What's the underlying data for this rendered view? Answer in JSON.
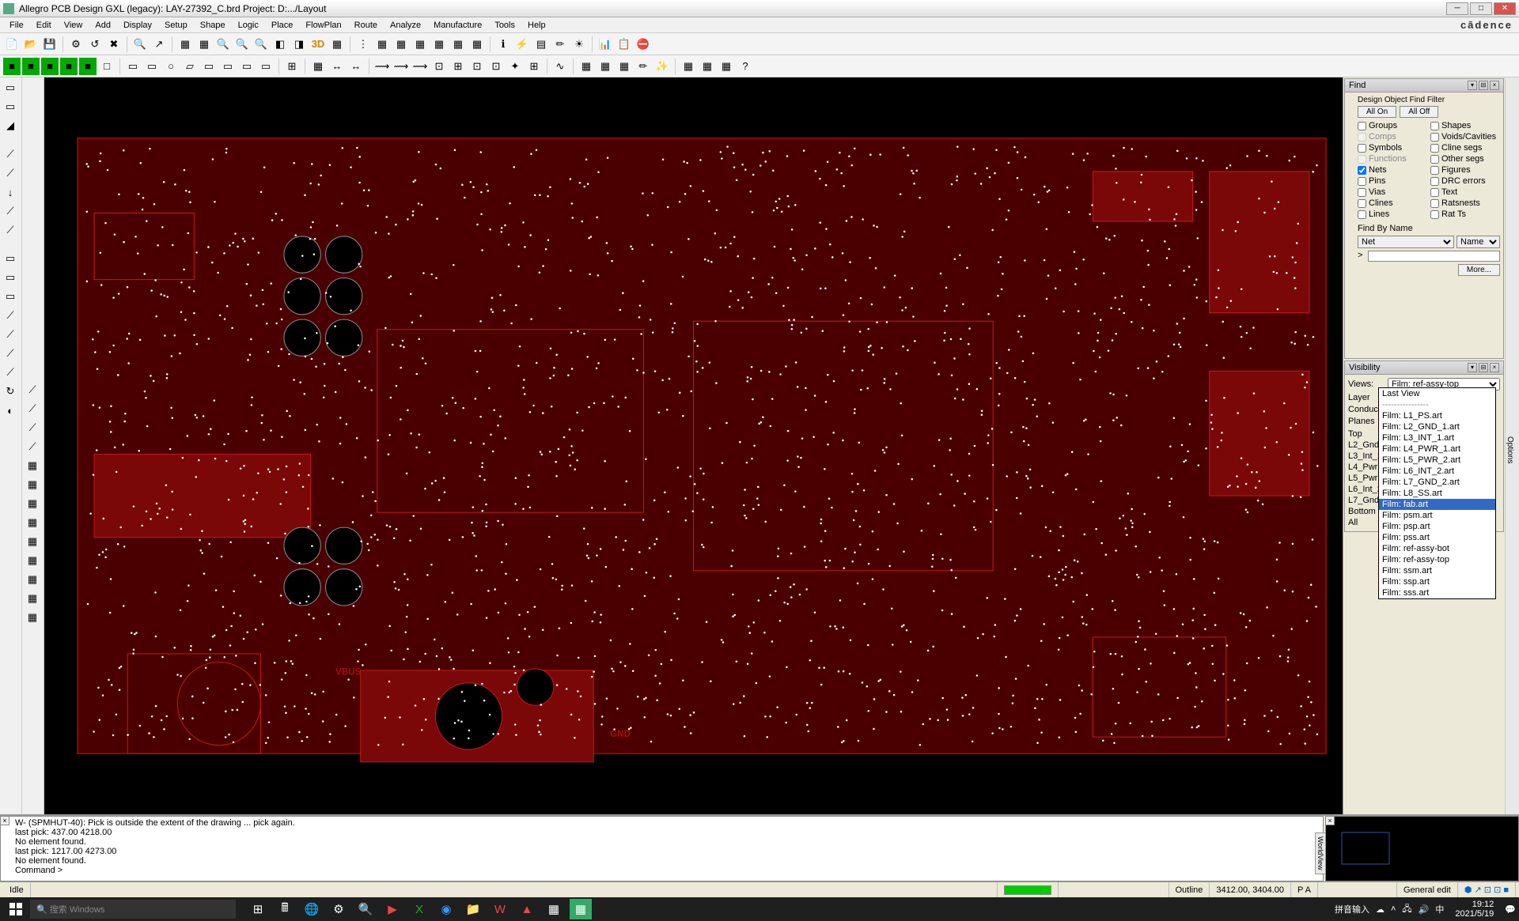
{
  "window": {
    "title": "Allegro PCB Design GXL (legacy): LAY-27392_C.brd  Project: D:.../Layout",
    "brand": "cādence"
  },
  "menus": [
    "File",
    "Edit",
    "View",
    "Add",
    "Display",
    "Setup",
    "Shape",
    "Logic",
    "Place",
    "FlowPlan",
    "Route",
    "Analyze",
    "Manufacture",
    "Tools",
    "Help"
  ],
  "find": {
    "title": "Find",
    "filter_label": "Design Object Find Filter",
    "all_on": "All On",
    "all_off": "All Off",
    "items_left": [
      {
        "label": "Groups",
        "checked": false,
        "disabled": false
      },
      {
        "label": "Comps",
        "checked": false,
        "disabled": true
      },
      {
        "label": "Symbols",
        "checked": false,
        "disabled": false
      },
      {
        "label": "Functions",
        "checked": false,
        "disabled": true
      },
      {
        "label": "Nets",
        "checked": true,
        "disabled": false
      },
      {
        "label": "Pins",
        "checked": false,
        "disabled": false
      },
      {
        "label": "Vias",
        "checked": false,
        "disabled": false
      },
      {
        "label": "Clines",
        "checked": false,
        "disabled": false
      },
      {
        "label": "Lines",
        "checked": false,
        "disabled": false
      }
    ],
    "items_right": [
      {
        "label": "Shapes",
        "checked": false,
        "disabled": false
      },
      {
        "label": "Voids/Cavities",
        "checked": false,
        "disabled": false
      },
      {
        "label": "Cline segs",
        "checked": false,
        "disabled": false
      },
      {
        "label": "Other segs",
        "checked": false,
        "disabled": false
      },
      {
        "label": "Figures",
        "checked": false,
        "disabled": false
      },
      {
        "label": "DRC errors",
        "checked": false,
        "disabled": false
      },
      {
        "label": "Text",
        "checked": false,
        "disabled": false
      },
      {
        "label": "Ratsnests",
        "checked": false,
        "disabled": false
      },
      {
        "label": "Rat Ts",
        "checked": false,
        "disabled": false
      }
    ],
    "by_name_label": "Find By Name",
    "type_select": "Net",
    "mode_select": "Name",
    "prompt": ">",
    "more": "More..."
  },
  "visibility": {
    "title": "Visibility",
    "views_label": "Views:",
    "views_value": "Film: ref-assy-top",
    "layer_label": "Layer",
    "conductor_label": "Conductor",
    "planes_label": "Planes",
    "rows": [
      "Top",
      "L2_Gnd",
      "L3_Int_1",
      "L4_Pwr",
      "L5_Pwr",
      "L6_Int_2",
      "L7_Gnd",
      "Bottom",
      "All"
    ],
    "dropdown": {
      "top": "Last View",
      "separator": "----------------",
      "items": [
        {
          "label": "Film: L1_PS.art",
          "hl": false
        },
        {
          "label": "Film: L2_GND_1.art",
          "hl": false
        },
        {
          "label": "Film: L3_INT_1.art",
          "hl": false
        },
        {
          "label": "Film: L4_PWR_1.art",
          "hl": false
        },
        {
          "label": "Film: L5_PWR_2.art",
          "hl": false
        },
        {
          "label": "Film: L6_INT_2.art",
          "hl": false
        },
        {
          "label": "Film: L7_GND_2.art",
          "hl": false
        },
        {
          "label": "Film: L8_SS.art",
          "hl": false
        },
        {
          "label": "Film: fab.art",
          "hl": true
        },
        {
          "label": "Film: psm.art",
          "hl": false
        },
        {
          "label": "Film: psp.art",
          "hl": false
        },
        {
          "label": "Film: pss.art",
          "hl": false
        },
        {
          "label": "Film: ref-assy-bot",
          "hl": false
        },
        {
          "label": "Film: ref-assy-top",
          "hl": false
        },
        {
          "label": "Film: ssm.art",
          "hl": false
        },
        {
          "label": "Film: ssp.art",
          "hl": false
        },
        {
          "label": "Film: sss.art",
          "hl": false
        }
      ]
    }
  },
  "console": {
    "lines": [
      "W- (SPMHUT-40): Pick is outside the extent of the drawing ... pick again.",
      "last pick:   437.00  4218.00",
      "No element found.",
      "last pick:  1217.00  4273.00",
      "No element found.",
      "Command >"
    ]
  },
  "status": {
    "idle": "Idle",
    "outline": "Outline",
    "coords": "3412.00, 3404.00",
    "pa": "P   A",
    "mode": "General edit"
  },
  "taskbar": {
    "search_placeholder": "搜索 Windows",
    "ime": "拼音输入",
    "time": "19:12",
    "date": "2021/5/19"
  },
  "right_tab": "Options"
}
